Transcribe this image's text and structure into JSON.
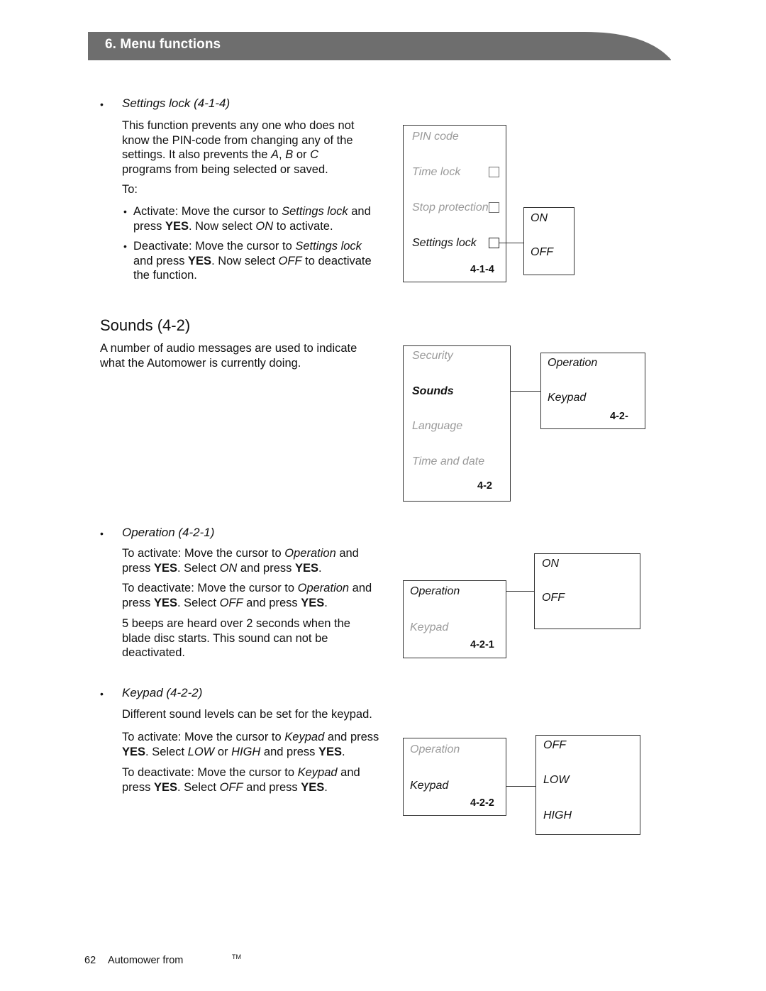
{
  "header": {
    "title": "6. Menu functions",
    "banner_color": "#6e6e6e"
  },
  "sections": [
    {
      "id": "settings-lock",
      "heading": "Settings lock (4-1-4)",
      "paragraphs": [
        "This function prevents any one who does not know the PIN-code from changing any of the settings. It also prevents the A, B or C programs from being selected or saved.",
        "To:"
      ],
      "bullets": [
        "Activate: Move the cursor to Settings lock and press YES. Now select ON to activate.",
        "Deactivate: Move the cursor to Settings lock and press YES. Now select OFF to deactivate the function."
      ]
    },
    {
      "id": "sounds",
      "heading": "Sounds (4-2)",
      "paragraphs": [
        "A number of audio messages are used to indicate what the Automower is currently doing."
      ]
    },
    {
      "id": "operation",
      "heading": "Operation (4-2-1)",
      "paragraphs": [
        "To activate: Move the cursor to Operation and press YES. Select ON and press YES.",
        "To deactivate: Move the cursor to Operation and press YES. Select OFF and press YES.",
        "5 beeps are heard over 2 seconds when the blade disc starts. This sound can not be deactivated."
      ]
    },
    {
      "id": "keypad",
      "heading": "Keypad (4-2-2)",
      "paragraphs": [
        "Different sound levels can be set for the keypad.",
        "To activate: Move the cursor to Keypad and press YES. Select LOW or HIGH and press YES.",
        "To deactivate: Move the cursor to Keypad and press YES. Select OFF and press YES."
      ]
    }
  ],
  "diagrams": {
    "settings_lock": {
      "menu_items": [
        "PIN code",
        "Time lock",
        "Stop protection",
        "Settings lock"
      ],
      "selected_item": "Settings lock",
      "code": "4-1-4",
      "options": [
        "ON",
        "OFF"
      ]
    },
    "sounds": {
      "menu_items": [
        "Security",
        "Sounds",
        "Language",
        "Time and date"
      ],
      "selected_item": "Sounds",
      "code": "4-2",
      "submenu_items": [
        "Operation",
        "Keypad"
      ],
      "submenu_code": "4-2-"
    },
    "operation": {
      "menu_items": [
        "Operation",
        "Keypad"
      ],
      "selected_item": "Operation",
      "code": "4-2-1",
      "options": [
        "ON",
        "OFF"
      ]
    },
    "keypad": {
      "menu_items": [
        "Operation",
        "Keypad"
      ],
      "selected_item": "Keypad",
      "code": "4-2-2",
      "options": [
        "OFF",
        "LOW",
        "HIGH"
      ]
    }
  },
  "footer": {
    "page_number": "62",
    "text": "Automower from",
    "trademark": "TM"
  }
}
